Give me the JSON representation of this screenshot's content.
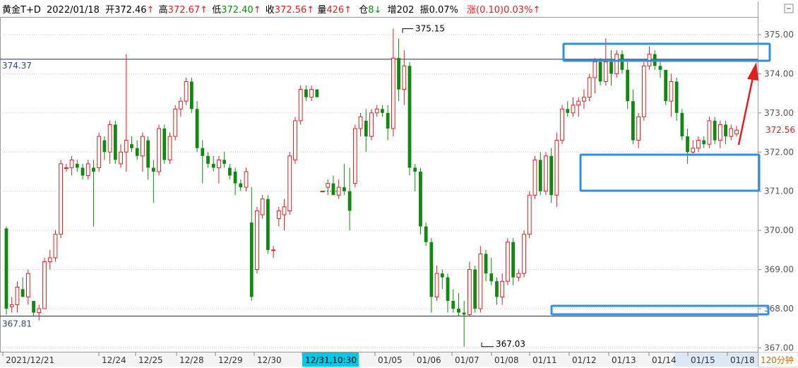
{
  "header": {
    "instrument": "黄金T+D",
    "date": "2022/01/18",
    "open_label": "开",
    "open": "372.46",
    "high_label": "高",
    "high": "372.67",
    "low_label": "低",
    "low": "372.40",
    "close_label": "收",
    "close": "372.56",
    "volume_label": "量",
    "volume": "426",
    "position_label": "仓",
    "position": "8",
    "increase_label": "增",
    "increase": "202",
    "amplitude_label": "振",
    "amplitude": "0.07%",
    "change_label": "涨",
    "change": "(0.10)",
    "change_pct": "0.03%",
    "up_arrow": "↑",
    "down_arrow": "↓"
  },
  "colors": {
    "up": "#d62020",
    "down": "#118811",
    "grid": "#c9c9c9",
    "marker_line": "#1b2f5a",
    "box": "#2f8fe6",
    "arrow": "#e02020",
    "highlight_bg": "#00c8e6",
    "period_bg": "#ffffff",
    "period_border": "#d0d0d0"
  },
  "chart_data": {
    "type": "candlestick",
    "ylim": [
      366.9,
      375.45
    ],
    "yticks": [
      "375.00",
      "374.00",
      "373.00",
      "372.00",
      "371.00",
      "370.00",
      "369.00",
      "368.00",
      "367.00"
    ],
    "ytick_values": [
      375,
      374,
      373,
      372,
      371,
      370,
      369,
      368,
      367
    ],
    "x_date_labels": [
      "2021/12/21",
      "12/24",
      "12/25",
      "12/28",
      "12/29",
      "12/30",
      "12/31,10:30",
      "01/05",
      "01/06",
      "01/07",
      "01/08",
      "01/11",
      "01/12",
      "01/13",
      "01/14",
      "01/15",
      "01/18"
    ],
    "highlighted_x_label": "12/31,10:30",
    "period": "120分钟",
    "reference_lines": [
      {
        "label": "374.37",
        "value": 374.37
      },
      {
        "label": "367.81",
        "value": 367.81
      }
    ],
    "annotations": [
      {
        "label": "375.15",
        "value": 375.15
      },
      {
        "label": "367.03",
        "value": 367.03
      }
    ],
    "last_price": "372.56",
    "candles": [
      [
        370.05,
        370.1,
        367.85,
        368.0
      ],
      [
        368.05,
        368.3,
        367.9,
        368.1
      ],
      [
        368.1,
        368.7,
        367.9,
        368.55
      ],
      [
        368.5,
        368.8,
        368.3,
        368.3
      ],
      [
        368.3,
        369.0,
        368.1,
        368.9
      ],
      [
        368.2,
        368.2,
        367.8,
        367.9
      ],
      [
        367.9,
        368.1,
        367.7,
        368.0
      ],
      [
        368.0,
        369.3,
        368.0,
        369.2
      ],
      [
        369.2,
        369.5,
        369.0,
        369.3
      ],
      [
        369.3,
        370.0,
        369.2,
        369.9
      ],
      [
        369.9,
        371.8,
        369.8,
        371.7
      ],
      [
        371.6,
        371.7,
        371.5,
        371.6
      ],
      [
        371.6,
        371.9,
        371.4,
        371.8
      ],
      [
        371.7,
        371.8,
        371.5,
        371.6
      ],
      [
        371.6,
        371.7,
        371.3,
        371.4
      ],
      [
        371.4,
        371.8,
        371.3,
        371.7
      ],
      [
        371.6,
        371.8,
        370.1,
        371.5
      ],
      [
        371.6,
        372.5,
        371.5,
        372.4
      ],
      [
        372.3,
        372.4,
        371.8,
        372.0
      ],
      [
        372.0,
        372.8,
        371.7,
        372.7
      ],
      [
        372.7,
        372.8,
        371.7,
        371.8
      ],
      [
        371.7,
        372.2,
        371.6,
        372.0
      ],
      [
        372.0,
        374.5,
        371.5,
        372.3
      ],
      [
        372.2,
        372.4,
        372.0,
        372.1
      ],
      [
        372.1,
        372.3,
        371.8,
        371.9
      ],
      [
        371.9,
        372.5,
        371.5,
        372.4
      ],
      [
        372.3,
        372.4,
        371.3,
        371.6
      ],
      [
        371.6,
        371.8,
        370.7,
        371.5
      ],
      [
        371.5,
        372.7,
        371.4,
        372.6
      ],
      [
        372.6,
        372.7,
        371.7,
        371.8
      ],
      [
        371.8,
        372.5,
        371.7,
        372.4
      ],
      [
        372.4,
        373.2,
        372.3,
        373.1
      ],
      [
        373.1,
        373.4,
        372.9,
        373.3
      ],
      [
        373.3,
        373.9,
        373.2,
        373.8
      ],
      [
        373.8,
        373.9,
        373.0,
        373.1
      ],
      [
        373.1,
        373.3,
        372.0,
        372.1
      ],
      [
        372.1,
        372.3,
        371.2,
        371.9
      ],
      [
        371.9,
        372.0,
        371.6,
        371.7
      ],
      [
        371.7,
        371.9,
        371.5,
        371.6
      ],
      [
        371.6,
        371.9,
        371.2,
        371.8
      ],
      [
        371.8,
        372.0,
        371.6,
        371.7
      ],
      [
        371.6,
        371.7,
        371.3,
        371.4
      ],
      [
        371.5,
        371.6,
        370.9,
        371.2
      ],
      [
        371.2,
        371.3,
        371.0,
        371.1
      ],
      [
        371.1,
        371.6,
        371.0,
        371.5
      ],
      [
        370.2,
        371.1,
        368.2,
        368.3
      ],
      [
        369.0,
        370.6,
        368.9,
        370.5
      ],
      [
        370.4,
        370.9,
        370.3,
        370.8
      ],
      [
        370.8,
        370.9,
        369.4,
        369.5
      ],
      [
        369.5,
        369.6,
        369.3,
        369.5
      ],
      [
        370.3,
        370.6,
        370.1,
        370.5
      ],
      [
        370.4,
        370.8,
        370.0,
        370.6
      ],
      [
        370.5,
        372.0,
        370.4,
        371.9
      ],
      [
        371.8,
        372.9,
        371.7,
        372.8
      ],
      [
        372.8,
        373.7,
        372.7,
        373.6
      ],
      [
        373.6,
        373.7,
        373.3,
        373.4
      ],
      [
        373.4,
        373.7,
        373.3,
        373.6
      ],
      [
        373.6,
        373.6,
        373.4,
        373.4
      ],
      [
        371.0,
        371.0,
        371.0,
        371.0
      ],
      [
        371.1,
        371.3,
        370.9,
        371.2
      ],
      [
        371.2,
        371.4,
        370.9,
        370.9
      ],
      [
        370.9,
        371.3,
        370.8,
        371.1
      ],
      [
        371.1,
        371.7,
        370.9,
        371.0
      ],
      [
        371.0,
        371.6,
        370.0,
        370.5
      ],
      [
        371.2,
        372.7,
        371.1,
        372.6
      ],
      [
        372.6,
        373.0,
        372.4,
        372.9
      ],
      [
        372.8,
        373.1,
        372.0,
        372.4
      ],
      [
        372.4,
        373.1,
        372.3,
        373.0
      ],
      [
        373.0,
        373.2,
        372.9,
        373.1
      ],
      [
        373.1,
        373.2,
        372.9,
        373.0
      ],
      [
        373.0,
        373.2,
        372.3,
        372.6
      ],
      [
        372.6,
        375.15,
        372.4,
        374.4
      ],
      [
        374.4,
        374.9,
        373.3,
        373.6
      ],
      [
        373.6,
        374.6,
        373.2,
        374.2
      ],
      [
        374.2,
        374.3,
        371.4,
        371.6
      ],
      [
        371.6,
        371.7,
        371.0,
        371.5
      ],
      [
        371.5,
        371.6,
        369.9,
        370.1
      ],
      [
        370.1,
        370.2,
        369.6,
        369.7
      ],
      [
        369.7,
        369.8,
        367.9,
        368.3
      ],
      [
        368.3,
        369.1,
        368.2,
        368.9
      ],
      [
        368.9,
        369.0,
        368.5,
        368.8
      ],
      [
        368.8,
        368.9,
        367.9,
        368.2
      ],
      [
        368.2,
        368.5,
        367.9,
        368.0
      ],
      [
        368.0,
        368.4,
        367.8,
        367.9
      ],
      [
        367.9,
        368.2,
        367.03,
        367.85
      ],
      [
        367.85,
        369.2,
        367.8,
        369.0
      ],
      [
        369.0,
        369.1,
        367.9,
        368.0
      ],
      [
        368.0,
        369.6,
        367.9,
        369.4
      ],
      [
        369.4,
        369.5,
        368.7,
        368.9
      ],
      [
        368.9,
        369.3,
        368.6,
        368.7
      ],
      [
        368.7,
        368.8,
        368.1,
        368.3
      ],
      [
        368.3,
        368.9,
        368.1,
        368.7
      ],
      [
        368.7,
        369.8,
        368.6,
        369.7
      ],
      [
        369.7,
        369.8,
        368.6,
        368.8
      ],
      [
        368.8,
        369.0,
        368.7,
        368.9
      ],
      [
        368.9,
        370.0,
        368.8,
        369.9
      ],
      [
        369.9,
        371.0,
        369.8,
        370.9
      ],
      [
        370.9,
        371.9,
        370.8,
        371.8
      ],
      [
        371.8,
        372.0,
        370.9,
        371.0
      ],
      [
        371.0,
        372.0,
        370.9,
        371.9
      ],
      [
        371.9,
        372.1,
        370.7,
        370.9
      ],
      [
        370.9,
        372.5,
        370.6,
        372.3
      ],
      [
        372.3,
        373.2,
        372.2,
        373.1
      ],
      [
        373.1,
        373.3,
        372.9,
        373.0
      ],
      [
        373.0,
        373.4,
        372.9,
        373.2
      ],
      [
        373.2,
        373.4,
        372.9,
        373.3
      ],
      [
        373.3,
        373.6,
        373.1,
        373.4
      ],
      [
        373.4,
        374.0,
        373.3,
        373.9
      ],
      [
        373.9,
        374.4,
        373.5,
        374.3
      ],
      [
        374.3,
        374.4,
        373.7,
        373.8
      ],
      [
        373.8,
        374.9,
        373.7,
        374.3
      ],
      [
        374.3,
        374.6,
        373.7,
        374.0
      ],
      [
        374.0,
        374.6,
        373.9,
        374.5
      ],
      [
        374.5,
        374.6,
        374.0,
        374.1
      ],
      [
        374.1,
        374.3,
        373.1,
        373.3
      ],
      [
        373.3,
        373.6,
        372.2,
        372.3
      ],
      [
        372.3,
        373.0,
        372.1,
        372.9
      ],
      [
        372.9,
        374.3,
        372.8,
        374.2
      ],
      [
        374.2,
        374.7,
        374.1,
        374.5
      ],
      [
        374.5,
        374.6,
        374.1,
        374.2
      ],
      [
        374.2,
        374.3,
        373.9,
        374.1
      ],
      [
        374.1,
        374.1,
        373.2,
        373.3
      ],
      [
        373.3,
        374.0,
        372.9,
        373.8
      ],
      [
        373.8,
        373.9,
        372.8,
        373.0
      ],
      [
        373.0,
        373.1,
        372.3,
        372.4
      ],
      [
        372.4,
        372.6,
        371.7,
        372.0
      ],
      [
        372.0,
        372.3,
        371.9,
        372.1
      ],
      [
        372.1,
        372.4,
        372.0,
        372.3
      ],
      [
        372.3,
        372.4,
        372.1,
        372.2
      ],
      [
        372.2,
        372.9,
        372.1,
        372.8
      ],
      [
        372.8,
        372.9,
        372.2,
        372.3
      ],
      [
        372.3,
        372.8,
        372.1,
        372.7
      ],
      [
        372.7,
        372.8,
        372.2,
        372.4
      ],
      [
        372.4,
        372.7,
        372.3,
        372.6
      ],
      [
        372.46,
        372.67,
        372.4,
        372.56
      ]
    ]
  }
}
